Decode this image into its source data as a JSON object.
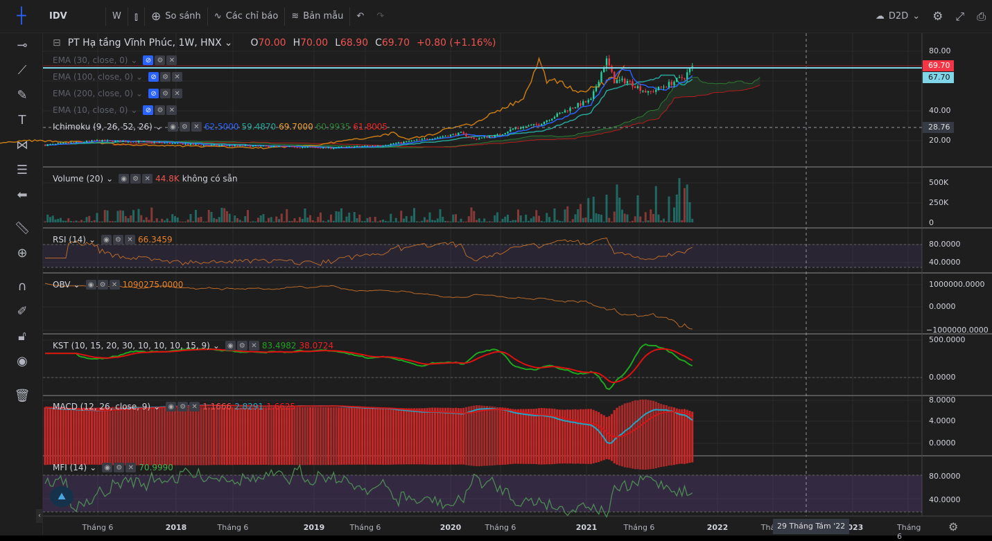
{
  "toolbar": {
    "symbol": "IDV",
    "interval": "W",
    "compare": "So sánh",
    "indicators": "Các chỉ báo",
    "templates": "Bản mẫu",
    "layout": "D2D"
  },
  "series": {
    "title": "PT Hạ tầng Vĩnh Phúc, 1W, HNX",
    "o_label": "O",
    "o": "70.00",
    "h_label": "H",
    "h": "70.00",
    "l_label": "L",
    "l": "68.90",
    "c_label": "C",
    "c": "69.70",
    "change": "+0.80 (+1.16%)"
  },
  "studies": {
    "ema30": "EMA (30, close, 0)",
    "ema100": "EMA (100, close, 0)",
    "ema200": "EMA (200, close, 0)",
    "ema10": "EMA (10, close, 0)",
    "ichimoku": {
      "label": "Ichimoku (9, 26, 52, 26)",
      "v1": "62.5000",
      "v2": "59.4870",
      "v3": "69.7000",
      "v4": "60.9935",
      "v5": "61.8005"
    },
    "volume": {
      "label": "Volume (20)",
      "value": "44.8K",
      "extra": "không có sẵn"
    },
    "rsi": {
      "label": "RSI (14)",
      "value": "66.3459"
    },
    "obv": {
      "label": "OBV",
      "value": "1090275.0000"
    },
    "kst": {
      "label": "KST (10, 15, 20, 30, 10, 10, 10, 15, 9)",
      "v1": "83.4982",
      "v2": "38.0724"
    },
    "macd": {
      "label": "MACD (12, 26, close, 9)",
      "v1": "1.1666",
      "v2": "2.8291",
      "v3": "1.6625"
    },
    "mfi": {
      "label": "MFI (14)",
      "value": "70.9990"
    }
  },
  "price_axis": {
    "main": [
      "80.00",
      "40.00",
      "20.00"
    ],
    "last": "69.70",
    "cyan": "67.70",
    "cross": "28.76",
    "volume": [
      "500K",
      "250K",
      "0"
    ],
    "rsi": [
      "80.0000",
      "40.0000"
    ],
    "obv": [
      "1000000.0000",
      "0.0000",
      "−1000000.0000"
    ],
    "kst": [
      "500.0000",
      "0.0000"
    ],
    "macd": [
      "8.0000",
      "4.0000",
      "0.0000"
    ],
    "mfi": [
      "80.0000",
      "40.0000"
    ]
  },
  "time_axis": [
    "Tháng 6",
    "2018",
    "Tháng 6",
    "2019",
    "Tháng 6",
    "2020",
    "Tháng 6",
    "2021",
    "Tháng 6",
    "2022",
    "Tháng",
    "2023",
    "Tháng 6"
  ],
  "crosshair_date": "29 Tháng Tám '22",
  "colors": {
    "up": "#26a69a",
    "down": "#ef5350",
    "bg": "#1e1e1e",
    "accent": "#2962ff"
  }
}
